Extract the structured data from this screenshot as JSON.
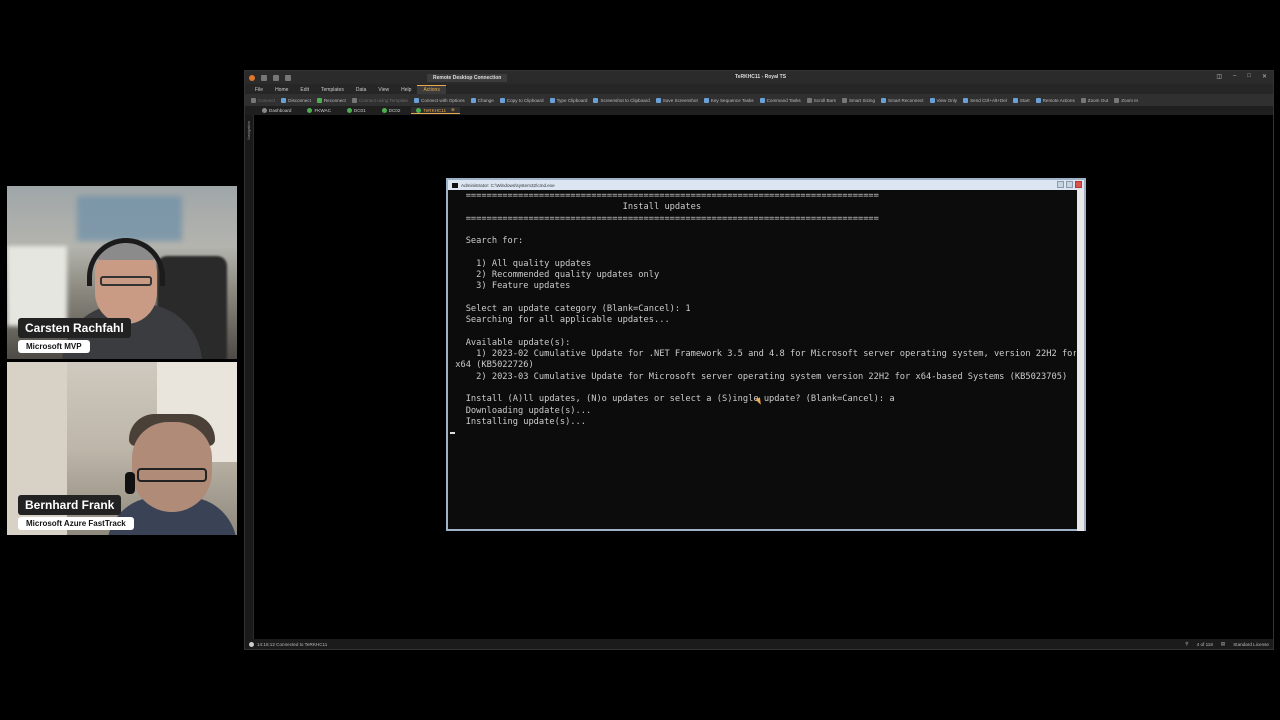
{
  "participants": [
    {
      "name": "Carsten Rachfahl",
      "role": "Microsoft MVP"
    },
    {
      "name": "Bernhard Frank",
      "role": "Microsoft Azure FastTrack"
    }
  ],
  "app": {
    "context_tab": "Remote Desktop Connection",
    "title": "TeRKHC11 - Royal TS",
    "window_controls": [
      "◫",
      "–",
      "□",
      "✕"
    ],
    "menu": [
      "File",
      "Home",
      "Edit",
      "Templates",
      "Data",
      "View",
      "Help",
      "Actions"
    ],
    "ribbon": [
      "Connect",
      "Disconnect",
      "Reconnect",
      "Connect using Template",
      "Connect with Options",
      "Change",
      "Copy to Clipboard",
      "Type Clipboard",
      "Screenshot to Clipboard",
      "Save Screenshot",
      "Key Sequence Tasks",
      "Command Tasks",
      "Scroll Bars",
      "Smart Sizing",
      "Smart Reconnect",
      "View Only",
      "Send Ctrl+Alt+Del",
      "Start",
      "Remote Actions",
      "Zoom Out",
      "Zoom In"
    ],
    "tabs": [
      "Dashboard",
      "FKWAC",
      "DC01",
      "DC02",
      "TeRKHC11"
    ],
    "navigation_label": "Navigation",
    "status_left": "14:16:12 Connected to TeRKHC11",
    "status_page": "4 of 118",
    "status_license": "Standard License"
  },
  "console": {
    "title": "Administrator: C:\\Windows\\system32\\cmd.exe",
    "lines": [
      "   ===============================================================================",
      "                                 Install updates",
      "   ===============================================================================",
      "",
      "   Search for:",
      "",
      "     1) All quality updates",
      "     2) Recommended quality updates only",
      "     3) Feature updates",
      "",
      "   Select an update category (Blank=Cancel): 1",
      "   Searching for all applicable updates...",
      "",
      "   Available update(s):",
      "     1) 2023-02 Cumulative Update for .NET Framework 3.5 and 4.8 for Microsoft server operating system, version 22H2 for",
      " x64 (KB5022726)",
      "     2) 2023-03 Cumulative Update for Microsoft server operating system version 22H2 for x64-based Systems (KB5023705)",
      "",
      "   Install (A)ll updates, (N)o updates or select a (S)ingle update? (Blank=Cancel): a",
      "   Downloading update(s)...",
      "   Installing update(s)..."
    ]
  }
}
